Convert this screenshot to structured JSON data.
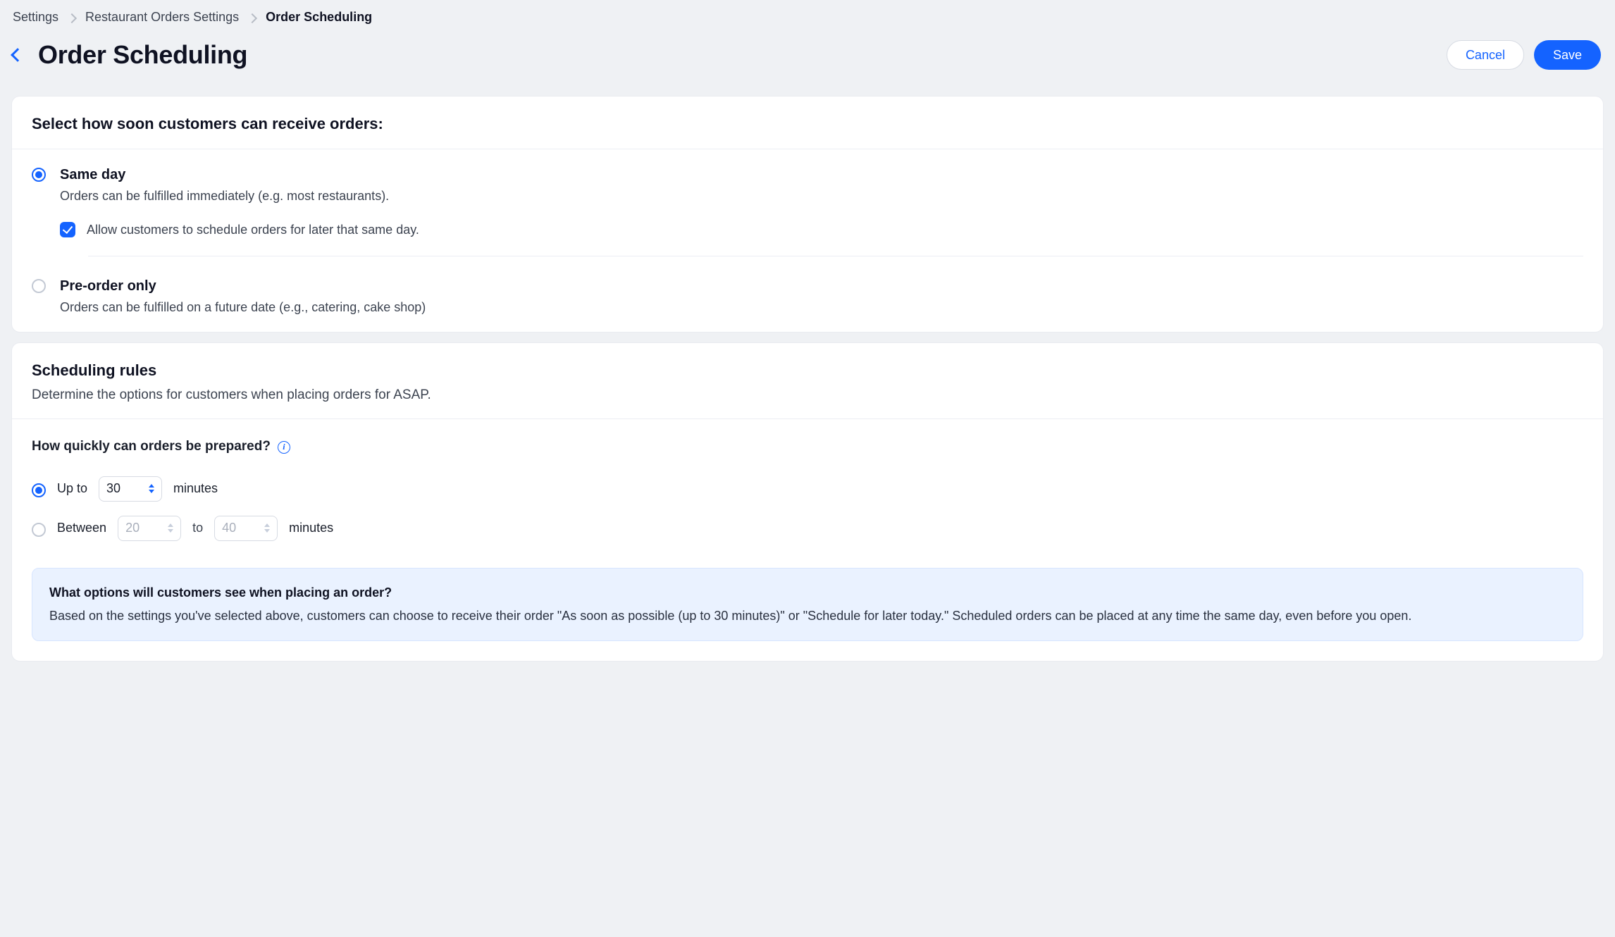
{
  "breadcrumb": {
    "items": [
      "Settings",
      "Restaurant Orders Settings",
      "Order Scheduling"
    ]
  },
  "header": {
    "title": "Order Scheduling",
    "cancel": "Cancel",
    "save": "Save"
  },
  "card1": {
    "title": "Select how soon customers can receive orders:",
    "sameDay": {
      "title": "Same day",
      "desc": "Orders can be fulfilled immediately (e.g. most restaurants).",
      "allowLater": "Allow customers to schedule orders for later that same day."
    },
    "preOrder": {
      "title": "Pre-order only",
      "desc": "Orders can be fulfilled on a future date (e.g., catering, cake shop)"
    }
  },
  "card2": {
    "title": "Scheduling rules",
    "subtitle": "Determine the options for customers when placing orders for ASAP.",
    "question": "How quickly can orders be prepared?",
    "upto": {
      "prefix": "Up to",
      "value": "30",
      "suffix": "minutes"
    },
    "between": {
      "prefix": "Between",
      "from": "20",
      "to_word": "to",
      "to": "40",
      "suffix": "minutes"
    },
    "callout": {
      "title": "What options will customers see when placing an order?",
      "body": "Based on the settings you've selected above, customers can choose to receive their order \"As soon as possible (up to 30 minutes)\" or \"Schedule for later today.\" Scheduled orders can be placed at any time the same day, even before you open."
    }
  }
}
